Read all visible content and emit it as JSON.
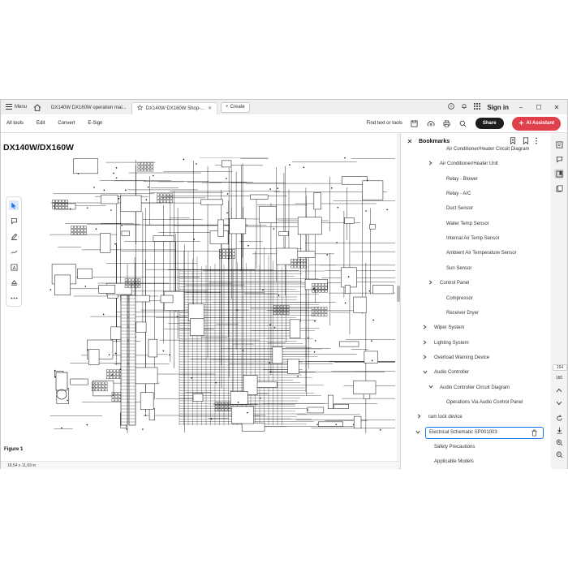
{
  "titlebar": {
    "menu_label": "Menu",
    "tabs": [
      {
        "label": "DX140W DX160W operation mai..."
      },
      {
        "label": "DX140W DX160W Shop-..."
      }
    ],
    "create_label": "Create",
    "sign_in": "Sign in"
  },
  "toolbar": {
    "items": [
      "All tools",
      "Edit",
      "Convert",
      "E-Sign"
    ],
    "find_label": "Find text or tools",
    "share_label": "Share",
    "ai_label": "AI Assistant"
  },
  "document": {
    "title": "DX140W/DX160W",
    "figure_label": "Figure 1",
    "page_size": "18,54 x 11,69 in"
  },
  "bookmarks": {
    "header": "Bookmarks",
    "items": [
      {
        "label": "Air Conditioner/Heater Circuit Diagram",
        "level": 3,
        "chevron": false
      },
      {
        "label": "Air Conditioner/Heater Unit",
        "level": 2,
        "chevron": "right"
      },
      {
        "label": "Relay - Blower",
        "level": 3,
        "chevron": false
      },
      {
        "label": "Relay - A/C",
        "level": 3,
        "chevron": false
      },
      {
        "label": "Duct Sensor",
        "level": 3,
        "chevron": false
      },
      {
        "label": "Water Temp Sensor",
        "level": 3,
        "chevron": false
      },
      {
        "label": "Internal Air Temp Sensor",
        "level": 3,
        "chevron": false
      },
      {
        "label": "Ambient Air Temperature Sensor",
        "level": 3,
        "chevron": false
      },
      {
        "label": "Sun Sensor",
        "level": 3,
        "chevron": false
      },
      {
        "label": "Control Panel",
        "level": 2,
        "chevron": "right"
      },
      {
        "label": "Compressor",
        "level": 3,
        "chevron": false
      },
      {
        "label": "Receiver Dryer",
        "level": 3,
        "chevron": false
      },
      {
        "label": "Wiper System",
        "level": 1,
        "chevron": "right"
      },
      {
        "label": "Lighting System",
        "level": 1,
        "chevron": "right"
      },
      {
        "label": "Overload Warning Device",
        "level": 1,
        "chevron": "right"
      },
      {
        "label": "Audio Controller",
        "level": 1,
        "chevron": "down"
      },
      {
        "label": "Audio Controller Circuit Diagram",
        "level": 2,
        "chevron": "down"
      },
      {
        "label": "Operations Via Audio Control Panel",
        "level": 3,
        "chevron": false
      },
      {
        "label": "ram lock device",
        "level": 0,
        "chevron": "right"
      },
      {
        "label": "Electrical Schematic SP001003",
        "level": 0,
        "chevron": "down",
        "selected": true
      },
      {
        "label": "Safety Precautions",
        "level": 1,
        "chevron": false
      },
      {
        "label": "Applicable Models",
        "level": 1,
        "chevron": false
      }
    ]
  },
  "rail": {
    "page_current": "154",
    "page_total": "180"
  },
  "colors": {
    "accent_blue": "#1473e6",
    "ai_red": "#e0404c",
    "share_black": "#1d1d1d"
  }
}
